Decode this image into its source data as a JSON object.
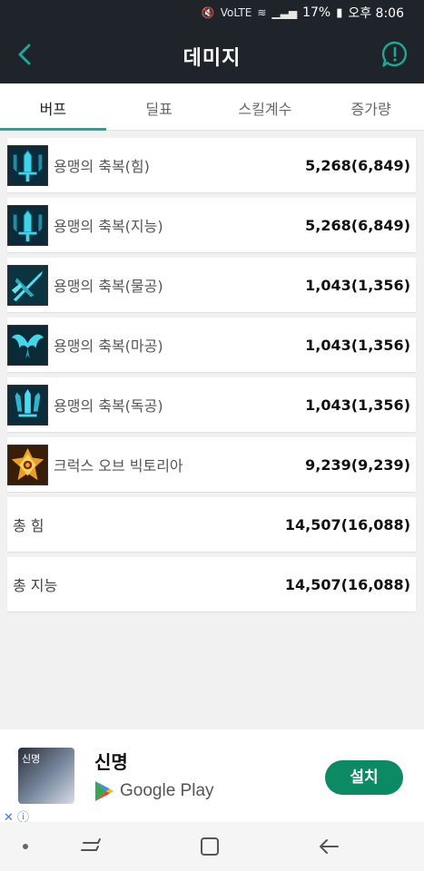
{
  "status_bar": {
    "battery": "17%",
    "time": "오후 8:06",
    "network": "VoLTE"
  },
  "app_bar": {
    "title": "데미지"
  },
  "tabs": [
    {
      "label": "버프"
    },
    {
      "label": "딜표"
    },
    {
      "label": "스킬계수"
    },
    {
      "label": "증가량"
    }
  ],
  "buffs": [
    {
      "name": "용맹의 축복(힘)",
      "value": "5,268(6,849)",
      "icon": "sword-blessing-icon"
    },
    {
      "name": "용맹의 축복(지능)",
      "value": "5,268(6,849)",
      "icon": "sword-blessing-icon"
    },
    {
      "name": "용맹의 축복(물공)",
      "value": "1,043(1,356)",
      "icon": "crossed-blades-icon"
    },
    {
      "name": "용맹의 축복(마공)",
      "value": "1,043(1,356)",
      "icon": "wings-icon"
    },
    {
      "name": "용맹의 축복(독공)",
      "value": "1,043(1,356)",
      "icon": "triple-blades-icon"
    },
    {
      "name": "크럭스 오브 빅토리아",
      "value": "9,239(9,239)",
      "icon": "golden-cross-icon"
    }
  ],
  "totals": [
    {
      "name": "총 힘",
      "value": "14,507(16,088)"
    },
    {
      "name": "총 지능",
      "value": "14,507(16,088)"
    }
  ],
  "ad": {
    "thumb_text": "신명",
    "title": "신명",
    "store": "Google Play",
    "install_label": "설치"
  },
  "colors": {
    "accent": "#1aa999",
    "header_bg": "#1f242b",
    "install_bg": "#0b8a63"
  }
}
